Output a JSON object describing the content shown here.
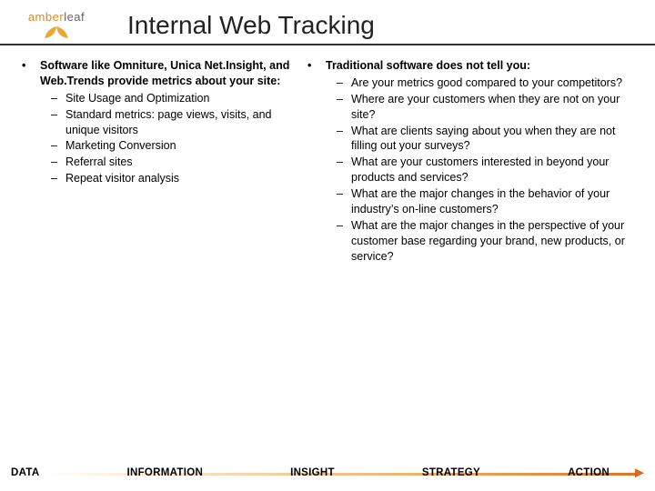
{
  "logo": {
    "part1": "amber",
    "part2": "leaf"
  },
  "title": "Internal Web Tracking",
  "left": {
    "lead": "Software like Omniture, Unica Net.Insight, and Web.Trends provide metrics about your site:",
    "items": [
      "Site Usage and Optimization",
      "Standard metrics:  page views, visits, and unique visitors",
      "Marketing Conversion",
      "Referral sites",
      "Repeat visitor analysis"
    ]
  },
  "right": {
    "lead": "Traditional software does not tell you:",
    "items": [
      "Are your metrics good compared to your competitors?",
      "Where are your customers when they are not on your site?",
      "What are clients saying about you when they are not filling out your surveys?",
      "What are your customers interested in beyond your products and services?",
      "What are the major changes in the behavior of your industry’s on-line customers?",
      "What are the major changes in the perspective of your customer base regarding your brand, new products, or service?"
    ]
  },
  "footer": [
    "DATA",
    "INFORMATION",
    "INSIGHT",
    "STRATEGY",
    "ACTION"
  ]
}
